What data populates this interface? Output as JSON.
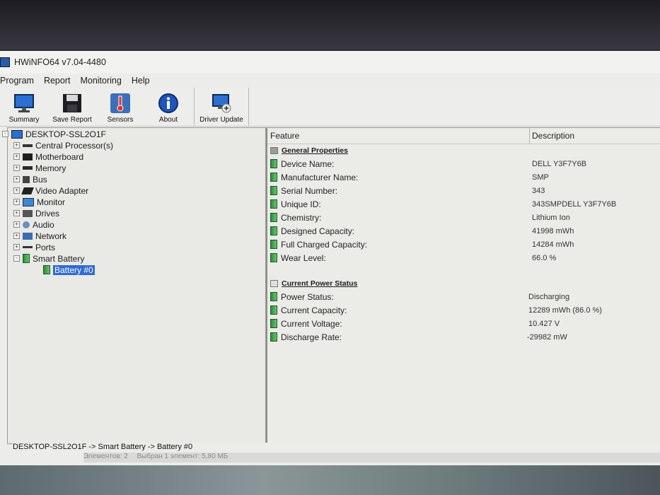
{
  "window": {
    "title": "HWiNFO64 v7.04-4480"
  },
  "menu": [
    "Program",
    "Report",
    "Monitoring",
    "Help"
  ],
  "toolbar": [
    {
      "label": "Summary",
      "icon": "monitor-icon"
    },
    {
      "label": "Save Report",
      "icon": "floppy-disk-icon"
    },
    {
      "label": "Sensors",
      "icon": "thermometer-icon"
    },
    {
      "label": "About",
      "icon": "info-icon"
    },
    {
      "label": "Driver Update",
      "icon": "driver-update-icon"
    }
  ],
  "tree": {
    "root": "DESKTOP-SSL2O1F",
    "items": [
      {
        "label": "Central Processor(s)",
        "expand": "+"
      },
      {
        "label": "Motherboard",
        "expand": "+"
      },
      {
        "label": "Memory",
        "expand": "+"
      },
      {
        "label": "Bus",
        "expand": "+"
      },
      {
        "label": "Video Adapter",
        "expand": "+"
      },
      {
        "label": "Monitor",
        "expand": "+"
      },
      {
        "label": "Drives",
        "expand": "+"
      },
      {
        "label": "Audio",
        "expand": "+"
      },
      {
        "label": "Network",
        "expand": "+"
      },
      {
        "label": "Ports",
        "expand": "+"
      },
      {
        "label": "Smart Battery",
        "expand": "-"
      }
    ],
    "selected_child": "Battery #0"
  },
  "details": {
    "col_feature": "Feature",
    "col_description": "Description",
    "general_title": "General Properties",
    "general": [
      {
        "feature": "Device Name:",
        "value": "DELL Y3F7Y6B"
      },
      {
        "feature": "Manufacturer Name:",
        "value": "SMP"
      },
      {
        "feature": "Serial Number:",
        "value": "343"
      },
      {
        "feature": "Unique ID:",
        "value": "343SMPDELL Y3F7Y6B"
      },
      {
        "feature": "Chemistry:",
        "value": "Lithium Ion"
      },
      {
        "feature": "Designed Capacity:",
        "value": "41998 mWh"
      },
      {
        "feature": "Full Charged Capacity:",
        "value": "14284 mWh"
      },
      {
        "feature": "Wear Level:",
        "value": "66.0 %"
      }
    ],
    "power_title": "Current Power Status",
    "power": [
      {
        "feature": "Power Status:",
        "value": "Discharging"
      },
      {
        "feature": "Current Capacity:",
        "value": "12289 mWh (86.0 %)"
      },
      {
        "feature": "Current Voltage:",
        "value": "10.427 V"
      },
      {
        "feature": "Discharge Rate:",
        "value": "-29982 mW"
      }
    ]
  },
  "status": {
    "path": "DESKTOP-SSL2O1F -> Smart Battery -> Battery #0"
  },
  "explorer_status": {
    "items": "Элементов: 2",
    "selected": "Выбран 1 элемент: 5,80 МБ"
  }
}
